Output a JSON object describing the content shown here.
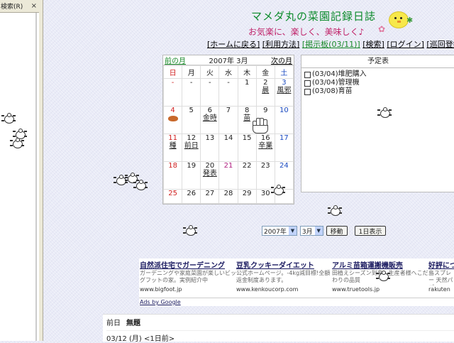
{
  "left_pane": {
    "label": "検索(R)",
    "close": "×"
  },
  "site": {
    "title": "マメダ丸の菜園記録日誌",
    "subtitle": "お気楽に、楽しく、美味しく♪",
    "flower": "✿",
    "sprout": "✱"
  },
  "nav": {
    "items": [
      {
        "label": "[ホームに戻る]"
      },
      {
        "label": "[利用方法]"
      },
      {
        "label": "[掲示板(03/11)]"
      },
      {
        "label": "[検索]"
      },
      {
        "label": "[ログイン]"
      },
      {
        "label": "[巡回登録"
      }
    ]
  },
  "calendar": {
    "prev": "前の月",
    "month": "2007年 3月",
    "next": "次の月",
    "weekdays": [
      "日",
      "月",
      "火",
      "水",
      "木",
      "金",
      "土"
    ],
    "weeks": [
      [
        {
          "d": "-"
        },
        {
          "d": "-"
        },
        {
          "d": "-"
        },
        {
          "d": "-"
        },
        {
          "d": "1"
        },
        {
          "d": "2",
          "ev": "晨"
        },
        {
          "d": "3",
          "ev": "風邪"
        }
      ],
      [
        {
          "d": "4"
        },
        {
          "d": "5"
        },
        {
          "d": "6",
          "ev": "金時"
        },
        {
          "d": "7"
        },
        {
          "d": "8",
          "ev": "苗"
        },
        {
          "d": "9"
        },
        {
          "d": "10"
        }
      ],
      [
        {
          "d": "11",
          "ev": "種"
        },
        {
          "d": "12",
          "ev": "前日"
        },
        {
          "d": "13"
        },
        {
          "d": "14"
        },
        {
          "d": "15"
        },
        {
          "d": "16",
          "ev": "辛業"
        },
        {
          "d": "17"
        }
      ],
      [
        {
          "d": "18"
        },
        {
          "d": "19"
        },
        {
          "d": "20",
          "ev": "発表"
        },
        {
          "d": "21"
        },
        {
          "d": "22"
        },
        {
          "d": "23"
        },
        {
          "d": "24"
        }
      ],
      [
        {
          "d": "25"
        },
        {
          "d": "26"
        },
        {
          "d": "27"
        },
        {
          "d": "28"
        },
        {
          "d": "29"
        },
        {
          "d": "30"
        },
        {
          "d": ""
        }
      ]
    ]
  },
  "schedule": {
    "title": "予定表",
    "items": [
      "(03/04)堆肥購入",
      "(03/04)管理機",
      "(03/08)育苗"
    ]
  },
  "controls": {
    "year": "2007年",
    "month": "3月",
    "move": "移動",
    "one_day": "1日表示"
  },
  "ads": {
    "items": [
      {
        "title": "自然派住宅でガーデニング",
        "desc": "ガーデニングや家庭菜園が楽しいビッグフットの家。実例紹介中",
        "url": "www.bigfoot.jp"
      },
      {
        "title": "豆乳クッキーダイエット",
        "desc": "公式ホームページ。-4kg減目標!全額返金制度あります。",
        "url": "www.kenkoucorp.com"
      },
      {
        "title": "アルミ苗箱運搬機販売",
        "desc": "田植えシーズン到来。生産者様へこだわりの品質",
        "url": "www.truetools.jp"
      },
      {
        "title": "好評につき",
        "desc": "島スプレー 天然パパ",
        "url": "rakuten"
      }
    ],
    "ads_by": "Ads by Google"
  },
  "diary": {
    "label": "前日",
    "title": "無題",
    "nav": "03/12 (月) <1日前>"
  },
  "colors": {
    "title_green": "#0a8a2a",
    "subtitle_pink": "#c0246a",
    "sunday_red": "#d02020",
    "saturday_blue": "#1a4ac0"
  }
}
